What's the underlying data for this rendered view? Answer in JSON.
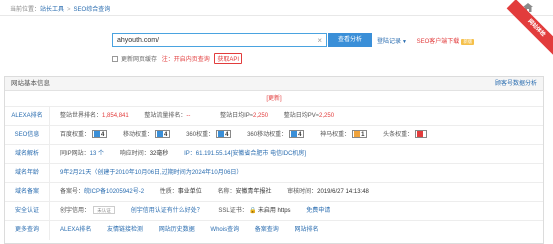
{
  "breadcrumb": {
    "prefix": "当前位置：",
    "items": [
      "站长工具",
      "SEO综合查询"
    ]
  },
  "ribbon": "网站体检",
  "search": {
    "value": "ahyouth.com/",
    "clear": "×",
    "button": "查看分析"
  },
  "header_links": {
    "login": "登陆记录",
    "caret": "▼",
    "download": "SEO客户端下载",
    "tag": "新版"
  },
  "options": {
    "update_label": "更新网页缓存",
    "note": "注：开启内页查询",
    "api": "获取API"
  },
  "panel": {
    "title": "网站基本信息",
    "more": "顾客号数据分析"
  },
  "top_line": "[更新]",
  "rows": {
    "alexa": {
      "label": "ALEXA排名",
      "world_rank_label": "整站世界排名：",
      "world_rank": "1,854,841",
      "traffic_rank_label": "整站流量排名：",
      "traffic_rank": "--",
      "daily_ip_label": "整站日均IP≈",
      "daily_ip": "2,250",
      "daily_pv_label": "整站日均PV≈",
      "daily_pv": "2,250"
    },
    "seo": {
      "label": "SEO信息",
      "baidu_label": "百度权重：",
      "baidu": "4",
      "mobile_label": "移动权重：",
      "mobile": "4",
      "s360_label": "360权重：",
      "s360": "4",
      "s360m_label": "360移动权重：",
      "s360m": "4",
      "shenma_label": "神马权重：",
      "shenma": "1",
      "toutiao_label": "头条权重："
    },
    "domain_parse": {
      "label": "域名解析",
      "same_ip_label": "同IP网站：",
      "same_ip": "13 个",
      "response_label": "响应时间：",
      "response": "32毫秒",
      "ip": "IP：61.191.55.14[安徽省合肥市 电信IDC机房]"
    },
    "domain_age": {
      "label": "域名年龄",
      "text": "9年2月21天（创建于2010年10月06日,过期时间为2024年10月06日）"
    },
    "beian": {
      "label": "域名备案",
      "no_label": "备案号：",
      "no": "皖ICP备10205942号-2",
      "nature_label": "性质：",
      "nature": "事业单位",
      "name_label": "名称：",
      "name": "安徽青年报社",
      "time_label": "审核时间：",
      "time": "2019/6/27 14:13:48"
    },
    "security": {
      "label": "安全认证",
      "trust_label": "创宇信用：",
      "trust_logo": "未认证",
      "trust_link": "创宇信用认证有什么好处？",
      "ssl_label": "SSL证书：",
      "https_lock": "🔒",
      "https_text": "未启用 https",
      "apply": "免费申请"
    },
    "more": {
      "label": "更多查询",
      "links": [
        "ALEXA排名",
        "友情链接检测",
        "网站历史数据",
        "Whois查询",
        "备案查询",
        "网站排名"
      ]
    }
  },
  "colors": {
    "accent_blue": "#3a8fd8",
    "link_blue": "#2a6db0",
    "alert_red": "#e23c3c"
  }
}
